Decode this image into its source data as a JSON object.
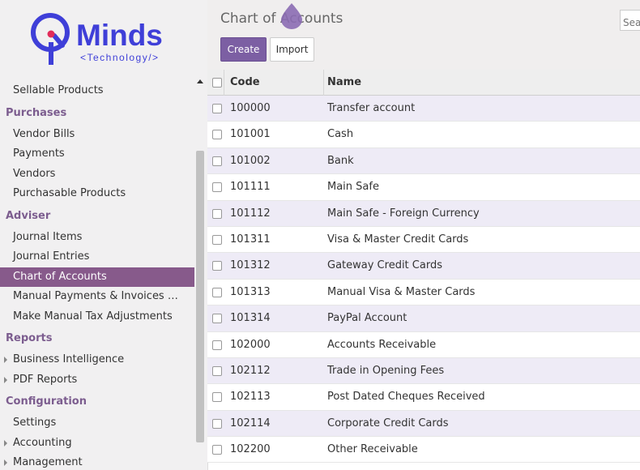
{
  "brand": {
    "name": "Minds",
    "tagline": "<Technology/>",
    "accent": "#3f3fd8",
    "dot": "#e22c5a"
  },
  "sidebar": {
    "items": [
      {
        "type": "item",
        "label": "Sellable Products"
      },
      {
        "type": "section",
        "label": "Purchases"
      },
      {
        "type": "item",
        "label": "Vendor Bills"
      },
      {
        "type": "item",
        "label": "Payments"
      },
      {
        "type": "item",
        "label": "Vendors"
      },
      {
        "type": "item",
        "label": "Purchasable Products"
      },
      {
        "type": "section",
        "label": "Adviser"
      },
      {
        "type": "item",
        "label": "Journal Items"
      },
      {
        "type": "item",
        "label": "Journal Entries"
      },
      {
        "type": "item",
        "label": "Chart of Accounts",
        "active": true
      },
      {
        "type": "item",
        "label": "Manual Payments & Invoices …"
      },
      {
        "type": "item",
        "label": "Make Manual Tax Adjustments"
      },
      {
        "type": "section",
        "label": "Reports"
      },
      {
        "type": "item",
        "label": "Business Intelligence",
        "expandable": true
      },
      {
        "type": "item",
        "label": "PDF Reports",
        "expandable": true
      },
      {
        "type": "section",
        "label": "Configuration"
      },
      {
        "type": "item",
        "label": "Settings"
      },
      {
        "type": "item",
        "label": "Accounting",
        "expandable": true
      },
      {
        "type": "item",
        "label": "Management",
        "expandable": true
      }
    ],
    "active_color": "#875a8b",
    "section_color": "#7c5d8f"
  },
  "control": {
    "title": "Chart of Accounts",
    "create_label": "Create",
    "import_label": "Import",
    "search_placeholder": "Search"
  },
  "table": {
    "headers": {
      "code": "Code",
      "name": "Name"
    },
    "rows": [
      {
        "code": "100000",
        "name": "Transfer account"
      },
      {
        "code": "101001",
        "name": "Cash"
      },
      {
        "code": "101002",
        "name": "Bank"
      },
      {
        "code": "101111",
        "name": "Main Safe"
      },
      {
        "code": "101112",
        "name": "Main Safe - Foreign Currency"
      },
      {
        "code": "101311",
        "name": "Visa & Master Credit Cards"
      },
      {
        "code": "101312",
        "name": "Gateway Credit Cards"
      },
      {
        "code": "101313",
        "name": "Manual Visa & Master Cards"
      },
      {
        "code": "101314",
        "name": "PayPal Account"
      },
      {
        "code": "102000",
        "name": "Accounts Receivable"
      },
      {
        "code": "102112",
        "name": "Trade in Opening Fees"
      },
      {
        "code": "102113",
        "name": "Post Dated Cheques Received"
      },
      {
        "code": "102114",
        "name": "Corporate Credit Cards"
      },
      {
        "code": "102200",
        "name": "Other Receivable"
      }
    ]
  }
}
